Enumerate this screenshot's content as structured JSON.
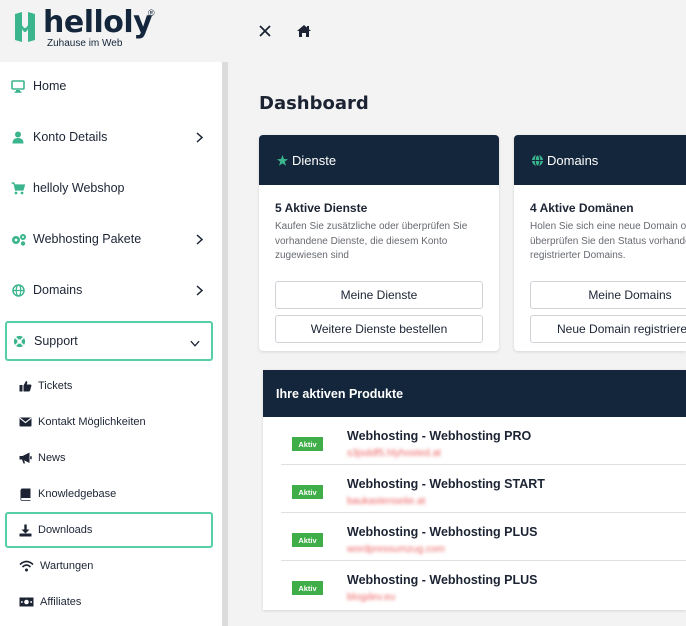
{
  "brand": {
    "name": "helloly",
    "registered": "®",
    "tagline": "Zuhause im Web",
    "accent": "#3bb58e",
    "navy": "#14263b"
  },
  "topbar": {
    "close_icon": "close-icon",
    "home_icon": "home-icon"
  },
  "sidebar": {
    "items": [
      {
        "label": "Home",
        "icon": "monitor-icon",
        "chevron": false
      },
      {
        "label": "Konto Details",
        "icon": "user-icon",
        "chevron": true
      },
      {
        "label": "helloly Webshop",
        "icon": "cart-icon",
        "chevron": false
      },
      {
        "label": "Webhosting Pakete",
        "icon": "gears-icon",
        "chevron": true
      },
      {
        "label": "Domains",
        "icon": "globe-icon",
        "chevron": true
      },
      {
        "label": "Support",
        "icon": "lifebuoy-icon",
        "chevron": true,
        "expanded": true
      }
    ],
    "support_submenu": [
      {
        "label": "Tickets",
        "icon": "thumbs-up-icon"
      },
      {
        "label": "Kontakt Möglichkeiten",
        "icon": "envelope-icon"
      },
      {
        "label": "News",
        "icon": "megaphone-icon"
      },
      {
        "label": "Knowledgebase",
        "icon": "book-icon"
      },
      {
        "label": "Downloads",
        "icon": "download-icon",
        "highlighted": true
      },
      {
        "label": "Wartungen",
        "icon": "wifi-icon"
      },
      {
        "label": "Affiliates",
        "icon": "money-icon"
      }
    ]
  },
  "main": {
    "title": "Dashboard",
    "cards": [
      {
        "header": "Dienste",
        "icon": "star-icon",
        "title": "5 Aktive Dienste",
        "description": "Kaufen Sie zusätzliche oder überprüfen Sie vorhandene Dienste, die diesem Konto zugewiesen sind",
        "buttons": [
          "Meine Dienste",
          "Weitere Dienste bestellen"
        ]
      },
      {
        "header": "Domains",
        "icon": "globe-icon",
        "title": "4 Aktive Domänen",
        "description": "Holen Sie sich eine neue Domain oder überprüfen Sie den Status vorhandener registrierter Domains.",
        "buttons": [
          "Meine Domains",
          "Neue Domain registrieren"
        ]
      }
    ],
    "products": {
      "header": "Ihre aktiven Produkte",
      "rows": [
        {
          "status": "Aktiv",
          "name": "Webhosting - Webhosting PRO",
          "domain": "s3jsddf5.hlyhosted.at"
        },
        {
          "status": "Aktiv",
          "name": "Webhosting - Webhosting START",
          "domain": "baukastenseite.at"
        },
        {
          "status": "Aktiv",
          "name": "Webhosting - Webhosting PLUS",
          "domain": "wordpressumzug.com"
        },
        {
          "status": "Aktiv",
          "name": "Webhosting - Webhosting PLUS",
          "domain": "blogdev.eu"
        }
      ]
    }
  }
}
